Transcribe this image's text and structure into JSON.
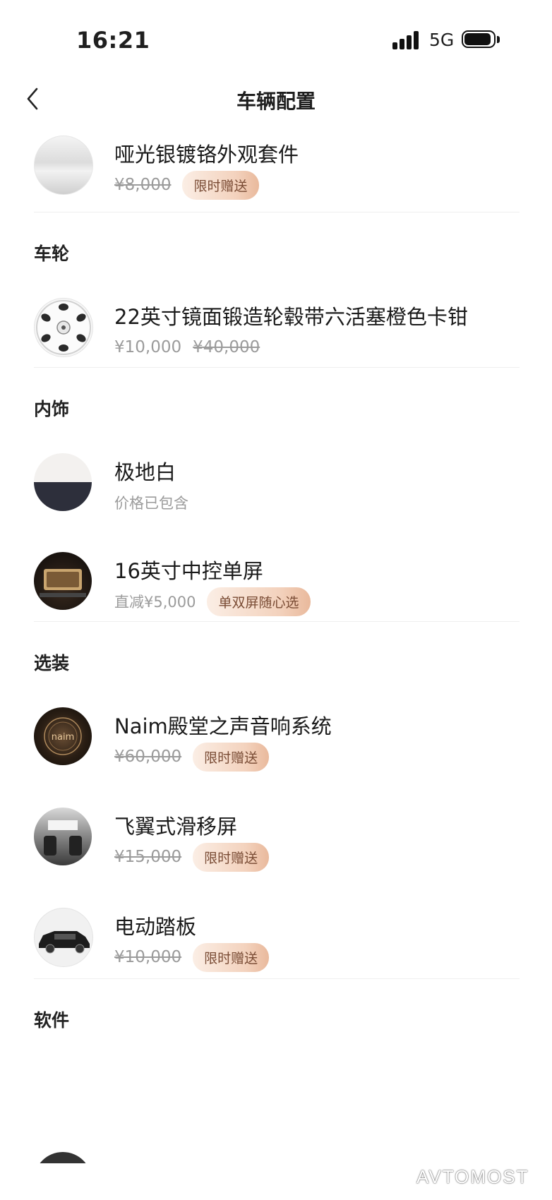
{
  "status_bar": {
    "time": "16:21",
    "network": "5G"
  },
  "nav": {
    "title": "车辆配置"
  },
  "sections": {
    "wheels": "车轮",
    "interior": "内饰",
    "options": "选装",
    "software": "软件"
  },
  "items": {
    "exterior_kit": {
      "name": "哑光银镀铬外观套件",
      "old_price": "¥8,000",
      "badge": "限时赠送"
    },
    "wheel": {
      "name": "22英寸镜面锻造轮毂带六活塞橙色卡钳",
      "price": "¥10,000",
      "old_price": "¥40,000"
    },
    "interior_color": {
      "name": "极地白",
      "sub": "价格已包含"
    },
    "screen": {
      "name": "16英寸中控单屏",
      "sub": "直减¥5,000",
      "badge": "单双屏随心选"
    },
    "naim": {
      "name": "Naim殿堂之声音响系统",
      "old_price": "¥60,000",
      "badge": "限时赠送"
    },
    "sliding_screen": {
      "name": "飞翼式滑移屏",
      "old_price": "¥15,000",
      "badge": "限时赠送"
    },
    "running_board": {
      "name": "电动踏板",
      "old_price": "¥10,000",
      "badge": "限时赠送"
    }
  },
  "icons": {
    "back": "chevron-left-icon",
    "signal": "cellular-signal-icon",
    "battery": "battery-icon"
  },
  "colors": {
    "badge_text": "#7a4c35",
    "muted": "#9b9b9b",
    "accent_badge": "#f3d2bd"
  },
  "watermark": "AVTOMOST"
}
